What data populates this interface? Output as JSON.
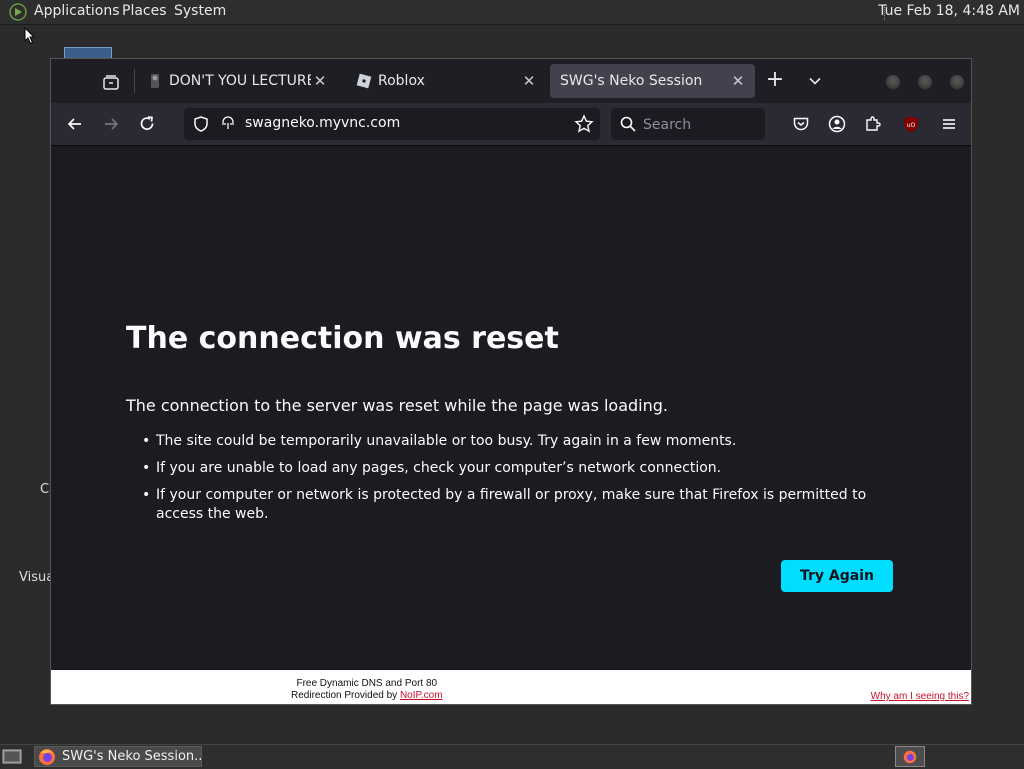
{
  "top_panel": {
    "menus": [
      "Applications",
      "Places",
      "System"
    ],
    "clock": "Tue Feb 18,  4:48 AM"
  },
  "desktop": {
    "labels": [
      "C",
      "Visua"
    ]
  },
  "browser": {
    "tabs": [
      {
        "label": "DON'T YOU LECTURE ME",
        "active": false
      },
      {
        "label": "Roblox",
        "active": false
      },
      {
        "label": "SWG's Neko Session",
        "active": true
      }
    ],
    "new_tab": "+",
    "url": "swagneko.myvnc.com",
    "search": {
      "placeholder": "Search",
      "value": ""
    },
    "error": {
      "title": "The connection was reset",
      "description": "The connection to the server was reset while the page was loading.",
      "bullets": [
        "The site could be temporarily unavailable or too busy. Try again in a few moments.",
        "If you are unable to load any pages, check your computer’s network connection.",
        "If your computer or network is protected by a firewall or proxy, make sure that Firefox is permitted to access the web."
      ],
      "button": "Try Again"
    },
    "banner": {
      "line1": "Free Dynamic DNS and Port 80",
      "line2_prefix": "Redirection Provided by ",
      "link": "NoIP.com",
      "why": "Why am I seeing this?"
    }
  },
  "taskbar": {
    "window_title": "SWG's Neko Session..."
  },
  "colors": {
    "accent_button": "#00ddff",
    "page_bg": "#1c1b22",
    "toolbar_bg": "#2b2a33",
    "link_red": "#c8102e"
  }
}
